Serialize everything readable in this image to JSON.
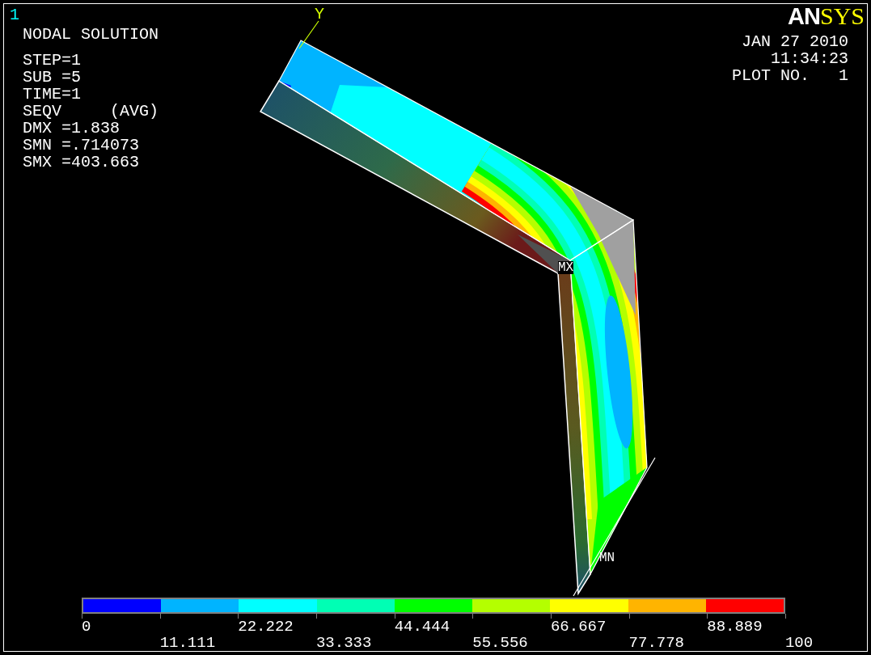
{
  "window": {
    "number": "1"
  },
  "logo": [
    "AN",
    "SYS"
  ],
  "title": "NODAL SOLUTION",
  "info": [
    "STEP=1",
    "SUB =5",
    "TIME=1",
    "SEQV     (AVG)",
    "DMX =1.838",
    "SMN =.714073",
    "SMX =403.663"
  ],
  "stamp": [
    "JAN 27 2010",
    "11:34:23",
    "PLOT NO.   1"
  ],
  "model_labels": [
    {
      "kind": "axis",
      "text": "Y"
    },
    {
      "kind": "max",
      "text": "MX"
    },
    {
      "kind": "min",
      "text": "MN"
    }
  ],
  "legend": {
    "segments": [
      {
        "color": "#0000ff"
      },
      {
        "color": "#00b4ff"
      },
      {
        "color": "#00ffff"
      },
      {
        "color": "#00ffb4"
      },
      {
        "color": "#00ff00"
      },
      {
        "color": "#b4ff00"
      },
      {
        "color": "#ffff00"
      },
      {
        "color": "#ffb400"
      },
      {
        "color": "#ff0000"
      }
    ],
    "ticks": [
      "0",
      "11.111",
      "22.222",
      "33.333",
      "44.444",
      "55.556",
      "66.667",
      "77.778",
      "88.889",
      "100"
    ]
  }
}
